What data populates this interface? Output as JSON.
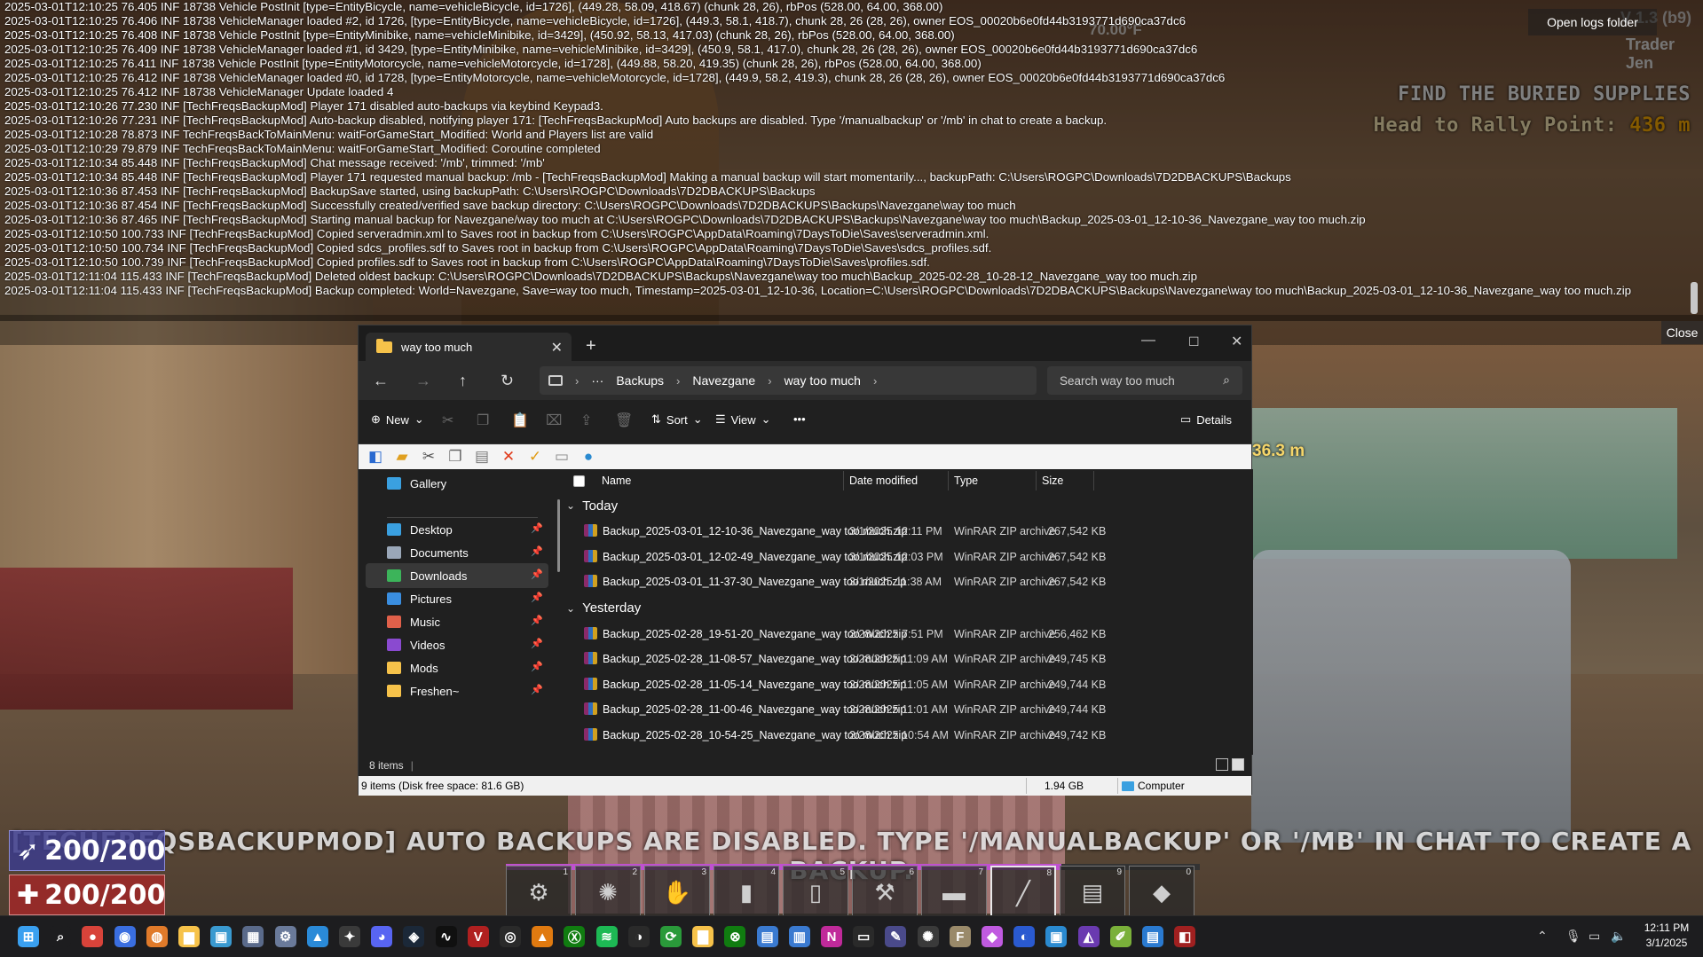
{
  "console": {
    "lines": [
      "2025-03-01T12:10:25 76.405 INF 18738 Vehicle PostInit [type=EntityBicycle, name=vehicleBicycle, id=1726], (449.28, 58.09, 418.67) (chunk 28, 26), rbPos (528.00, 64.00, 368.00)",
      "2025-03-01T12:10:25 76.406 INF 18738 VehicleManager loaded #2, id 1726, [type=EntityBicycle, name=vehicleBicycle, id=1726], (449.3, 58.1, 418.7), chunk 28, 26 (28, 26), owner EOS_00020b6e0fd44b3193771d690ca37dc6",
      "2025-03-01T12:10:25 76.408 INF 18738 Vehicle PostInit [type=EntityMinibike, name=vehicleMinibike, id=3429], (450.92, 58.13, 417.03) (chunk 28, 26), rbPos (528.00, 64.00, 368.00)",
      "2025-03-01T12:10:25 76.409 INF 18738 VehicleManager loaded #1, id 3429, [type=EntityMinibike, name=vehicleMinibike, id=3429], (450.9, 58.1, 417.0), chunk 28, 26 (28, 26), owner EOS_00020b6e0fd44b3193771d690ca37dc6",
      "2025-03-01T12:10:25 76.411 INF 18738 Vehicle PostInit [type=EntityMotorcycle, name=vehicleMotorcycle, id=1728], (449.88, 58.20, 419.35) (chunk 28, 26), rbPos (528.00, 64.00, 368.00)",
      "2025-03-01T12:10:25 76.412 INF 18738 VehicleManager loaded #0, id 1728, [type=EntityMotorcycle, name=vehicleMotorcycle, id=1728], (449.9, 58.2, 419.3), chunk 28, 26 (28, 26), owner EOS_00020b6e0fd44b3193771d690ca37dc6",
      "2025-03-01T12:10:25 76.412 INF 18738 VehicleManager Update loaded 4",
      "2025-03-01T12:10:26 77.230 INF [TechFreqsBackupMod] Player 171 disabled auto-backups via keybind Keypad3.",
      "2025-03-01T12:10:26 77.231 INF [TechFreqsBackupMod] Auto-backup disabled, notifying player 171: [TechFreqsBackupMod] Auto backups are disabled. Type '/manualbackup' or '/mb' in chat to create a backup.",
      "2025-03-01T12:10:28 78.873 INF TechFreqsBackToMainMenu: waitForGameStart_Modified: World and Players list are valid",
      "2025-03-01T12:10:29 79.879 INF TechFreqsBackToMainMenu: waitForGameStart_Modified: Coroutine completed",
      "2025-03-01T12:10:34 85.448 INF [TechFreqsBackupMod] Chat message received: '/mb', trimmed: '/mb'",
      "2025-03-01T12:10:34 85.448 INF [TechFreqsBackupMod] Player 171 requested manual backup: /mb - [TechFreqsBackupMod] Making a manual backup will start momentarily..., backupPath: C:\\Users\\ROGPC\\Downloads\\7D2DBACKUPS\\Backups",
      "2025-03-01T12:10:36 87.453 INF [TechFreqsBackupMod] BackupSave started, using backupPath: C:\\Users\\ROGPC\\Downloads\\7D2DBACKUPS\\Backups",
      "2025-03-01T12:10:36 87.454 INF [TechFreqsBackupMod] Successfully created/verified save backup directory: C:\\Users\\ROGPC\\Downloads\\7D2DBACKUPS\\Backups\\Navezgane\\way too much",
      "2025-03-01T12:10:36 87.465 INF [TechFreqsBackupMod] Starting manual backup for Navezgane/way too much at C:\\Users\\ROGPC\\Downloads\\7D2DBACKUPS\\Backups\\Navezgane\\way too much\\Backup_2025-03-01_12-10-36_Navezgane_way too much.zip",
      "2025-03-01T12:10:50 100.733 INF [TechFreqsBackupMod] Copied serveradmin.xml to Saves root in backup from C:\\Users\\ROGPC\\AppData\\Roaming\\7DaysToDie\\Saves\\serveradmin.xml.",
      "2025-03-01T12:10:50 100.734 INF [TechFreqsBackupMod] Copied sdcs_profiles.sdf to Saves root in backup from C:\\Users\\ROGPC\\AppData\\Roaming\\7DaysToDie\\Saves\\sdcs_profiles.sdf.",
      "2025-03-01T12:10:50 100.739 INF [TechFreqsBackupMod] Copied profiles.sdf to Saves root in backup from C:\\Users\\ROGPC\\AppData\\Roaming\\7DaysToDie\\Saves\\profiles.sdf.",
      "2025-03-01T12:11:04 115.433 INF [TechFreqsBackupMod] Deleted oldest backup: C:\\Users\\ROGPC\\Downloads\\7D2DBACKUPS\\Backups\\Navezgane\\way too much\\Backup_2025-02-28_10-28-12_Navezgane_way too much.zip",
      "2025-03-01T12:11:04 115.433 INF [TechFreqsBackupMod] Backup completed: World=Navezgane, Save=way too much, Timestamp=2025-03-01_12-10-36, Location=C:\\Users\\ROGPC\\Downloads\\7D2DBACKUPS\\Backups\\Navezgane\\way too much\\Backup_2025-03-01_12-10-36_Navezgane_way too much.zip"
    ],
    "open_logs_label": "Open logs folder",
    "close_label": "Close"
  },
  "hud": {
    "version": "V 1.3 (b9)",
    "trader": "Trader Jen",
    "temperature": "70.00°F",
    "quest_title": "FIND THE BURIED SUPPLIES",
    "quest_sub": "Head to Rally Point:",
    "quest_distance": "436 m",
    "marker_distance": "36.3 m",
    "banner": "[TECHFREQSBACKUPMOD] AUTO BACKUPS ARE DISABLED. TYPE '/MANUALBACKUP' OR '/MB' IN CHAT TO CREATE A BACKUP.",
    "stamina": "200/200",
    "health": "200/200",
    "hotbar_progress": 0.8,
    "hotbar": [
      {
        "num": "1",
        "icon": "wrench-icon",
        "glyph": "⚙"
      },
      {
        "num": "2",
        "icon": "sawblade-icon",
        "glyph": "✺"
      },
      {
        "num": "3",
        "icon": "claw-icon",
        "glyph": "✋"
      },
      {
        "num": "4",
        "icon": "glue-icon",
        "glyph": "▮"
      },
      {
        "num": "5",
        "icon": "can-icon",
        "glyph": "▯"
      },
      {
        "num": "6",
        "icon": "shovel-icon",
        "glyph": "⚒"
      },
      {
        "num": "7",
        "icon": "bandage-icon",
        "glyph": "▬"
      },
      {
        "num": "8",
        "icon": "knife-icon",
        "glyph": "╱"
      },
      {
        "num": "9",
        "icon": "book-icon",
        "glyph": "▤"
      },
      {
        "num": "0",
        "icon": "fuel-icon",
        "glyph": "◆"
      }
    ]
  },
  "explorer": {
    "tab_title": "way too much",
    "breadcrumb": [
      "Backups",
      "Navezgane",
      "way too much"
    ],
    "search_placeholder": "Search way too much",
    "cmd": {
      "new": "New",
      "sort": "Sort",
      "view": "View",
      "details": "Details"
    },
    "sidebar": [
      {
        "label": "Gallery",
        "icon": "gallery-icon",
        "color": "#3aa0e0"
      },
      {
        "label": "Desktop",
        "icon": "desktop-icon",
        "color": "#3aa0e0"
      },
      {
        "label": "Documents",
        "icon": "documents-icon",
        "color": "#9aa7b8"
      },
      {
        "label": "Downloads",
        "icon": "downloads-icon",
        "color": "#3cb45a"
      },
      {
        "label": "Pictures",
        "icon": "pictures-icon",
        "color": "#3a8ee0"
      },
      {
        "label": "Music",
        "icon": "music-icon",
        "color": "#e0604a"
      },
      {
        "label": "Videos",
        "icon": "videos-icon",
        "color": "#8a4ad0"
      },
      {
        "label": "Mods",
        "icon": "folder-icon",
        "color": "#f6c24a"
      },
      {
        "label": "Freshen~",
        "icon": "folder-icon",
        "color": "#f6c24a"
      }
    ],
    "columns": {
      "name": "Name",
      "date": "Date modified",
      "type": "Type",
      "size": "Size"
    },
    "groups": [
      {
        "label": "Today",
        "files": [
          {
            "name": "Backup_2025-03-01_12-10-36_Navezgane_way too much.zip",
            "date": "3/1/2025 12:11 PM",
            "type": "WinRAR ZIP archive",
            "size": "267,542 KB"
          },
          {
            "name": "Backup_2025-03-01_12-02-49_Navezgane_way too much.zip",
            "date": "3/1/2025 12:03 PM",
            "type": "WinRAR ZIP archive",
            "size": "267,542 KB"
          },
          {
            "name": "Backup_2025-03-01_11-37-30_Navezgane_way too much.zip",
            "date": "3/1/2025 11:38 AM",
            "type": "WinRAR ZIP archive",
            "size": "267,542 KB"
          }
        ]
      },
      {
        "label": "Yesterday",
        "files": [
          {
            "name": "Backup_2025-02-28_19-51-20_Navezgane_way too much.zip",
            "date": "2/28/2025 7:51 PM",
            "type": "WinRAR ZIP archive",
            "size": "256,462 KB"
          },
          {
            "name": "Backup_2025-02-28_11-08-57_Navezgane_way too much.zip",
            "date": "2/28/2025 11:09 AM",
            "type": "WinRAR ZIP archive",
            "size": "249,745 KB"
          },
          {
            "name": "Backup_2025-02-28_11-05-14_Navezgane_way too much.zip",
            "date": "2/28/2025 11:05 AM",
            "type": "WinRAR ZIP archive",
            "size": "249,744 KB"
          },
          {
            "name": "Backup_2025-02-28_11-00-46_Navezgane_way too much.zip",
            "date": "2/28/2025 11:01 AM",
            "type": "WinRAR ZIP archive",
            "size": "249,744 KB"
          },
          {
            "name": "Backup_2025-02-28_10-54-25_Navezgane_way too much.zip",
            "date": "2/28/2025 10:54 AM",
            "type": "WinRAR ZIP archive",
            "size": "249,742 KB"
          }
        ]
      }
    ],
    "item_count": "8 items",
    "status_items": "9 items (Disk free space: 81.6 GB)",
    "status_size": "1.94 GB",
    "status_location": "Computer"
  },
  "taskbar": {
    "icons": [
      {
        "name": "start-icon",
        "color": "#3aa0f0",
        "glyph": "⊞"
      },
      {
        "name": "search-icon",
        "color": "#1d1d1f",
        "glyph": "⌕"
      },
      {
        "name": "chrome-icon",
        "color": "#d8433a",
        "glyph": "●"
      },
      {
        "name": "copilot-icon",
        "color": "#3a6ee0",
        "glyph": "◉"
      },
      {
        "name": "firefox-icon",
        "color": "#e07a2a",
        "glyph": "◍"
      },
      {
        "name": "file-explorer-icon",
        "color": "#f6c24a",
        "glyph": "▆"
      },
      {
        "name": "remote-desktop-icon",
        "color": "#3a9ad0",
        "glyph": "▣"
      },
      {
        "name": "calculator-icon",
        "color": "#5a6a8a",
        "glyph": "▦"
      },
      {
        "name": "settings-icon",
        "color": "#6a7a9a",
        "glyph": "⚙"
      },
      {
        "name": "photos-icon",
        "color": "#2a8ad8",
        "glyph": "▲"
      },
      {
        "name": "game-icon",
        "color": "#3a3a3a",
        "glyph": "✦"
      },
      {
        "name": "discord-icon",
        "color": "#5865f2",
        "glyph": "◕"
      },
      {
        "name": "steam-icon",
        "color": "#1b2838",
        "glyph": "◈"
      },
      {
        "name": "terminal-wave-icon",
        "color": "#101010",
        "glyph": "∿"
      },
      {
        "name": "voicemeeter-icon",
        "color": "#b02020",
        "glyph": "V"
      },
      {
        "name": "obs-icon",
        "color": "#2a2a2a",
        "glyph": "◎"
      },
      {
        "name": "vlc-icon",
        "color": "#e07a10",
        "glyph": "▲"
      },
      {
        "name": "xbox-app-icon",
        "color": "#107c10",
        "glyph": "Ⓧ"
      },
      {
        "name": "spotify-icon",
        "color": "#1db954",
        "glyph": "≋"
      },
      {
        "name": "steam-deck-icon",
        "color": "#2a2a2a",
        "glyph": "◑"
      },
      {
        "name": "sync-icon",
        "color": "#2a9a3a",
        "glyph": "⟳"
      },
      {
        "name": "folder2-icon",
        "color": "#f6c24a",
        "glyph": "▇"
      },
      {
        "name": "xbox-icon",
        "color": "#107c10",
        "glyph": "⊗"
      },
      {
        "name": "store-icon",
        "color": "#3a7ad0",
        "glyph": "▤"
      },
      {
        "name": "apps-icon",
        "color": "#3a7ad0",
        "glyph": "▥"
      },
      {
        "name": "onenote-icon",
        "color": "#c02a9a",
        "glyph": "N"
      },
      {
        "name": "cmd-icon",
        "color": "#2a2a2a",
        "glyph": "▭"
      },
      {
        "name": "editor-icon",
        "color": "#4a4a8a",
        "glyph": "✎"
      },
      {
        "name": "chatgpt-icon",
        "color": "#3a3a3a",
        "glyph": "✺"
      },
      {
        "name": "fo-icon",
        "color": "#9a8a6a",
        "glyph": "F"
      },
      {
        "name": "copilot2-icon",
        "color": "#c05ae0",
        "glyph": "◆"
      },
      {
        "name": "browser-icon",
        "color": "#2a5ad0",
        "glyph": "◐"
      },
      {
        "name": "rdp-icon",
        "color": "#2a8ad0",
        "glyph": "▣"
      },
      {
        "name": "visual-studio-icon",
        "color": "#6a3ab0",
        "glyph": "◭"
      },
      {
        "name": "notepadpp-icon",
        "color": "#7ab03a",
        "glyph": "✐"
      },
      {
        "name": "notepad-icon",
        "color": "#2a7ad0",
        "glyph": "▤"
      },
      {
        "name": "game2-icon",
        "color": "#a02020",
        "glyph": "◧"
      }
    ],
    "time": "12:11 PM",
    "date": "3/1/2025"
  }
}
